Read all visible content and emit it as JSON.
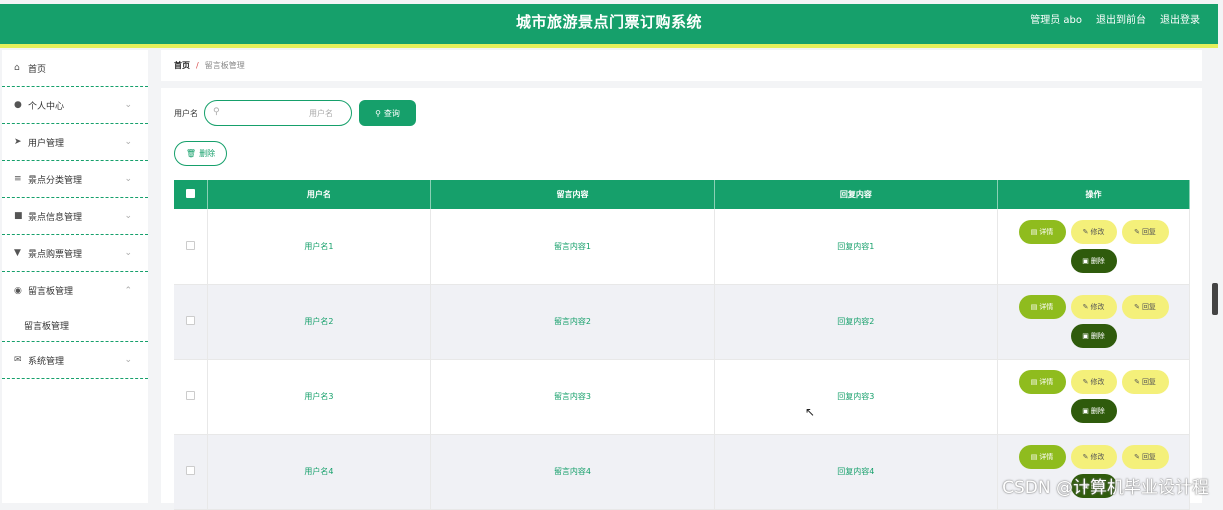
{
  "header": {
    "title": "城市旅游景点门票订购系统",
    "admin": "管理员 abo",
    "frontend": "退出到前台",
    "logout": "退出登录"
  },
  "sidebar": {
    "items": [
      {
        "label": "首页",
        "icon": "home-icon",
        "chevron": ""
      },
      {
        "label": "个人中心",
        "icon": "user-icon",
        "chevron": "⌄"
      },
      {
        "label": "用户管理",
        "icon": "send-icon",
        "chevron": "⌄"
      },
      {
        "label": "景点分类管理",
        "icon": "sliders-icon",
        "chevron": "⌄"
      },
      {
        "label": "景点信息管理",
        "icon": "thumb-icon",
        "chevron": "⌄"
      },
      {
        "label": "景点购票管理",
        "icon": "trophy-icon",
        "chevron": "⌄"
      },
      {
        "label": "留言板管理",
        "icon": "location-icon",
        "chevron": "⌃"
      },
      {
        "label": "系统管理",
        "icon": "mail-icon",
        "chevron": "⌄"
      }
    ],
    "submenu": "留言板管理"
  },
  "breadcrumb": {
    "home": "首页",
    "sep": "/",
    "current": "留言板管理"
  },
  "search": {
    "label": "用户名",
    "placeholder": "用户名",
    "button": "查询"
  },
  "actions": {
    "delete": "删除"
  },
  "table": {
    "headers": [
      "用户名",
      "留言内容",
      "回复内容",
      "操作"
    ],
    "rows": [
      {
        "username": "用户名1",
        "message": "留言内容1",
        "reply": "回复内容1"
      },
      {
        "username": "用户名2",
        "message": "留言内容2",
        "reply": "回复内容2"
      },
      {
        "username": "用户名3",
        "message": "留言内容3",
        "reply": "回复内容3"
      },
      {
        "username": "用户名4",
        "message": "留言内容4",
        "reply": "回复内容4"
      }
    ],
    "op_labels": {
      "detail": "详情",
      "edit": "修改",
      "reply": "回复",
      "delete": "删除"
    }
  },
  "watermark": "CSDN @计算机毕业设计程",
  "colors": {
    "primary": "#16a06b",
    "accent_strip": "#e4ef5a",
    "detail": "#8fbc1e",
    "edit": "#f4f07a",
    "delete": "#2f5b0c"
  }
}
